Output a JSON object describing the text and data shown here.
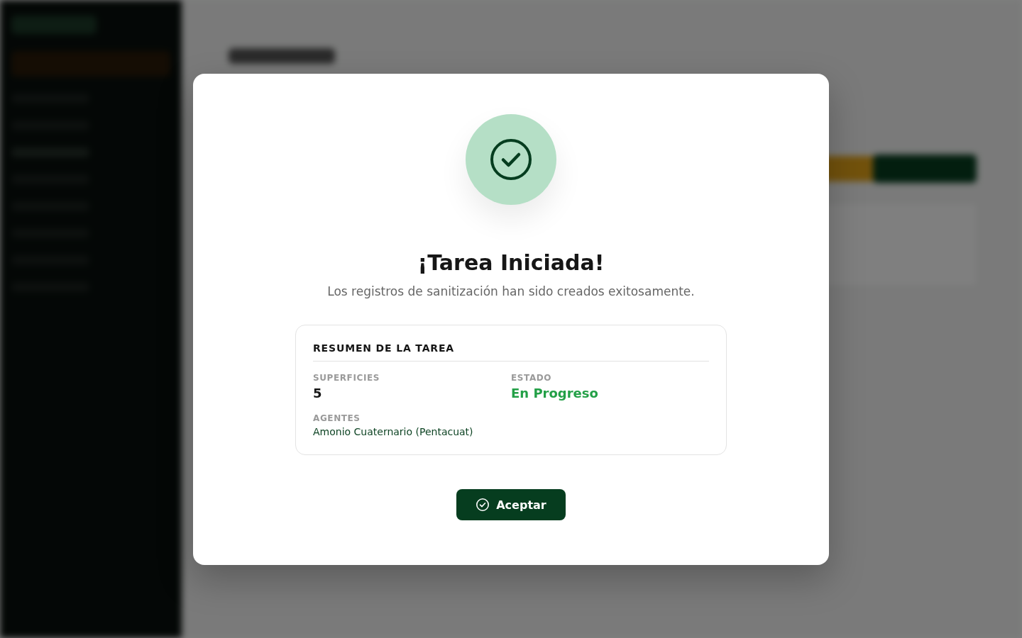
{
  "dialog": {
    "title": "¡Tarea Iniciada!",
    "message": "Los registros de sanitización han sido creados exitosamente.",
    "summary": {
      "heading": "RESUMEN DE LA TAREA",
      "fields": [
        {
          "label": "SUPERFICIES",
          "value": "5",
          "kind": "count"
        },
        {
          "label": "ESTADO",
          "value": "En Progreso",
          "kind": "status"
        },
        {
          "label": "AGENTES",
          "value": "Amonio Cuaternario (Pentacuat)",
          "kind": "agent"
        }
      ]
    },
    "button": "Aceptar"
  }
}
